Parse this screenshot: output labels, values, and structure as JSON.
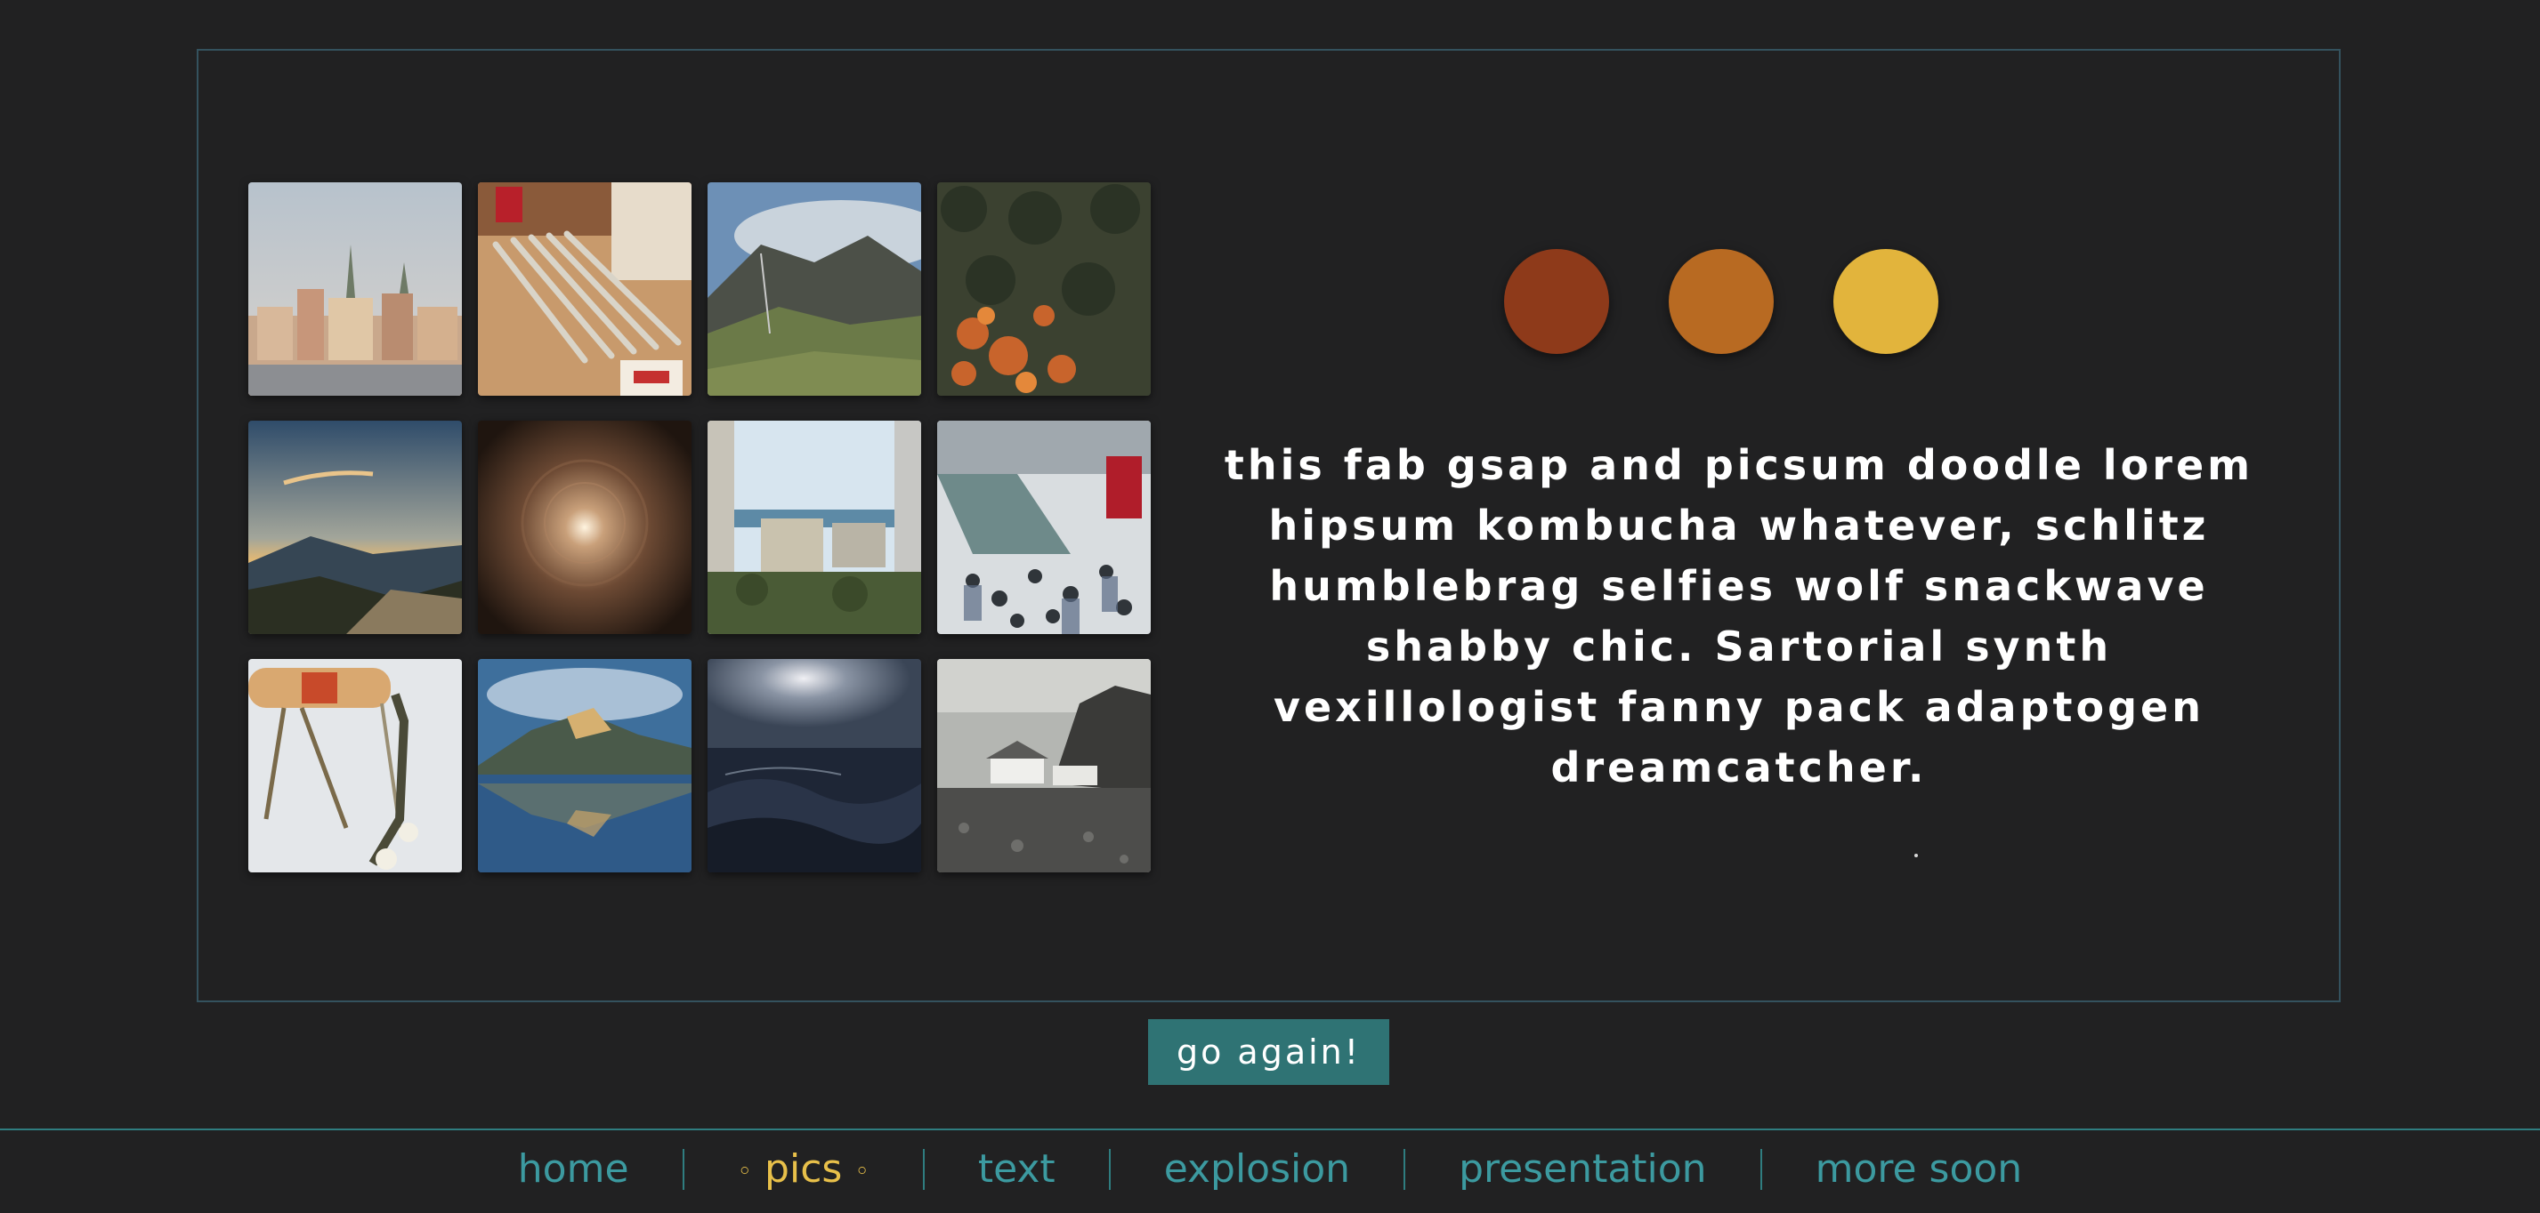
{
  "gallery": {
    "tiles": [
      {
        "name": "city-skyline-photo"
      },
      {
        "name": "pencils-photo"
      },
      {
        "name": "mountain-valley-photo"
      },
      {
        "name": "autumn-forest-photo"
      },
      {
        "name": "sunset-hills-photo"
      },
      {
        "name": "light-tunnel-photo"
      },
      {
        "name": "coastal-buildings-photo"
      },
      {
        "name": "crowd-escalator-photo"
      },
      {
        "name": "skateboard-photo"
      },
      {
        "name": "lake-reflection-photo"
      },
      {
        "name": "ocean-wave-photo"
      },
      {
        "name": "cliff-cottage-photo"
      }
    ]
  },
  "palette": {
    "colors": [
      "#8e3a1a",
      "#b86a22",
      "#e2b43c"
    ]
  },
  "blurb": {
    "text": "this fab gsap and picsum doodle lorem hipsum kombucha whatever, schlitz humblebrag selfies wolf snackwave shabby chic. Sartorial synth vexillologist fanny pack adaptogen dreamcatcher."
  },
  "actions": {
    "go_again_label": "go again!"
  },
  "nav": {
    "items": [
      {
        "label": "home",
        "active": false
      },
      {
        "label": "pics",
        "active": true,
        "decor": "◦"
      },
      {
        "label": "text",
        "active": false
      },
      {
        "label": "explosion",
        "active": false
      },
      {
        "label": "presentation",
        "active": false
      },
      {
        "label": "more soon",
        "active": false
      }
    ]
  }
}
